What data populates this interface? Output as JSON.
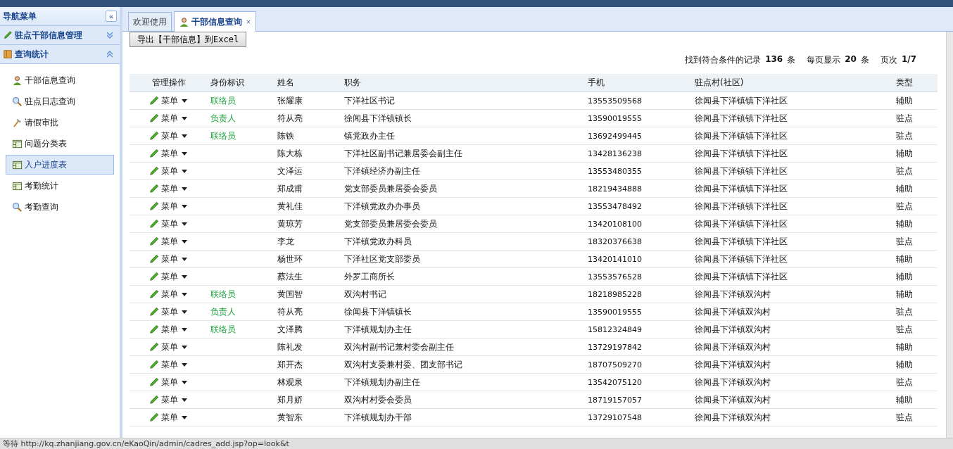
{
  "sidebar": {
    "title": "导航菜单",
    "collapse_icon": "«",
    "groups": [
      {
        "label": "驻点干部信息管理",
        "kind": "pencil",
        "expanded": false
      },
      {
        "label": "查询统计",
        "kind": "folder",
        "expanded": true,
        "items": [
          {
            "label": "干部信息查询",
            "kind": "person",
            "selected": false
          },
          {
            "label": "驻点日志查询",
            "kind": "search",
            "selected": false
          },
          {
            "label": "请假审批",
            "kind": "hammer",
            "selected": false
          },
          {
            "label": "问题分类表",
            "kind": "table",
            "selected": false
          },
          {
            "label": "入户进度表",
            "kind": "table",
            "selected": true
          },
          {
            "label": "考勤统计",
            "kind": "table",
            "selected": false
          },
          {
            "label": "考勤查询",
            "kind": "search",
            "selected": false
          }
        ]
      }
    ]
  },
  "tabs": [
    {
      "label": "欢迎使用",
      "selected": false,
      "closable": false
    },
    {
      "label": "干部信息查询",
      "selected": true,
      "closable": true
    }
  ],
  "export_button": "导出【干部信息】到Excel",
  "summary": {
    "found_label": "找到符合条件的记录",
    "found": "136",
    "unit1": "条",
    "per_page_label": "每页显示",
    "per_page": "20",
    "unit2": "条",
    "page_label": "页次",
    "page": "1/7"
  },
  "table": {
    "columns": [
      "管理操作",
      "身份标识",
      "姓名",
      "职务",
      "手机",
      "驻点村(社区)",
      "类型"
    ],
    "rows": [
      {
        "menu": "菜单",
        "role": "联络员",
        "name": "张耀康",
        "title": "下洋社区书记",
        "phone": "13553509568",
        "village": "徐闻县下洋镇镇下洋社区",
        "type": "辅助"
      },
      {
        "menu": "菜单",
        "role": "负责人",
        "name": "符从亮",
        "title": "徐闻县下洋镇镇长",
        "phone": "13590019555",
        "village": "徐闻县下洋镇镇下洋社区",
        "type": "驻点"
      },
      {
        "menu": "菜单",
        "role": "联络员",
        "name": "陈铁",
        "title": "镇党政办主任",
        "phone": "13692499445",
        "village": "徐闻县下洋镇镇下洋社区",
        "type": "驻点"
      },
      {
        "menu": "菜单",
        "name": "陈大栋",
        "title": "下洋社区副书记兼居委会副主任",
        "phone": "13428136238",
        "village": "徐闻县下洋镇镇下洋社区",
        "type": "辅助"
      },
      {
        "menu": "菜单",
        "name": "文泽运",
        "title": "下洋镇经济办副主任",
        "phone": "13553480355",
        "village": "徐闻县下洋镇镇下洋社区",
        "type": "驻点"
      },
      {
        "menu": "菜单",
        "name": "郑成甫",
        "title": "党支部委员兼居委会委员",
        "phone": "18219434888",
        "village": "徐闻县下洋镇镇下洋社区",
        "type": "辅助"
      },
      {
        "menu": "菜单",
        "name": "黄礼佳",
        "title": "下洋镇党政办办事员",
        "phone": "13553478492",
        "village": "徐闻县下洋镇镇下洋社区",
        "type": "驻点"
      },
      {
        "menu": "菜单",
        "name": "黄琼芳",
        "title": "党支部委员兼居委会委员",
        "phone": "13420108100",
        "village": "徐闻县下洋镇镇下洋社区",
        "type": "辅助"
      },
      {
        "menu": "菜单",
        "name": "李龙",
        "title": "下洋镇党政办科员",
        "phone": "18320376638",
        "village": "徐闻县下洋镇镇下洋社区",
        "type": "驻点"
      },
      {
        "menu": "菜单",
        "name": "杨世环",
        "title": "下洋社区党支部委员",
        "phone": "13420141010",
        "village": "徐闻县下洋镇镇下洋社区",
        "type": "辅助"
      },
      {
        "menu": "菜单",
        "name": "蔡法生",
        "title": "外罗工商所长",
        "phone": "13553576528",
        "village": "徐闻县下洋镇镇下洋社区",
        "type": "辅助"
      },
      {
        "menu": "菜单",
        "role": "联络员",
        "name": "黄国智",
        "title": "双沟村书记",
        "phone": "18218985228",
        "village": "徐闻县下洋镇双沟村",
        "type": "辅助"
      },
      {
        "menu": "菜单",
        "role": "负责人",
        "name": "符从亮",
        "title": "徐闻县下洋镇镇长",
        "phone": "13590019555",
        "village": "徐闻县下洋镇双沟村",
        "type": "驻点"
      },
      {
        "menu": "菜单",
        "role": "联络员",
        "name": "文泽腾",
        "title": "下洋镇规划办主任",
        "phone": "15812324849",
        "village": "徐闻县下洋镇双沟村",
        "type": "驻点"
      },
      {
        "menu": "菜单",
        "name": "陈礼发",
        "title": "双沟村副书记兼村委会副主任",
        "phone": "13729197842",
        "village": "徐闻县下洋镇双沟村",
        "type": "辅助"
      },
      {
        "menu": "菜单",
        "name": "郑开杰",
        "title": "双沟村支委兼村委、团支部书记",
        "phone": "18707509270",
        "village": "徐闻县下洋镇双沟村",
        "type": "辅助"
      },
      {
        "menu": "菜单",
        "name": "林观泉",
        "title": "下洋镇规划办副主任",
        "phone": "13542075120",
        "village": "徐闻县下洋镇双沟村",
        "type": "驻点"
      },
      {
        "menu": "菜单",
        "name": "郑月娇",
        "title": "双沟村村委会委员",
        "phone": "18719157057",
        "village": "徐闻县下洋镇双沟村",
        "type": "辅助"
      },
      {
        "menu": "菜单",
        "name": "黄智东",
        "title": "下洋镇规划办干部",
        "phone": "13729107548",
        "village": "徐闻县下洋镇双沟村",
        "type": "驻点"
      }
    ]
  },
  "status_bar": "等待 http://kq.zhanjiang.gov.cn/eKaoQin/admin/cadres_add.jsp?op=look&t"
}
